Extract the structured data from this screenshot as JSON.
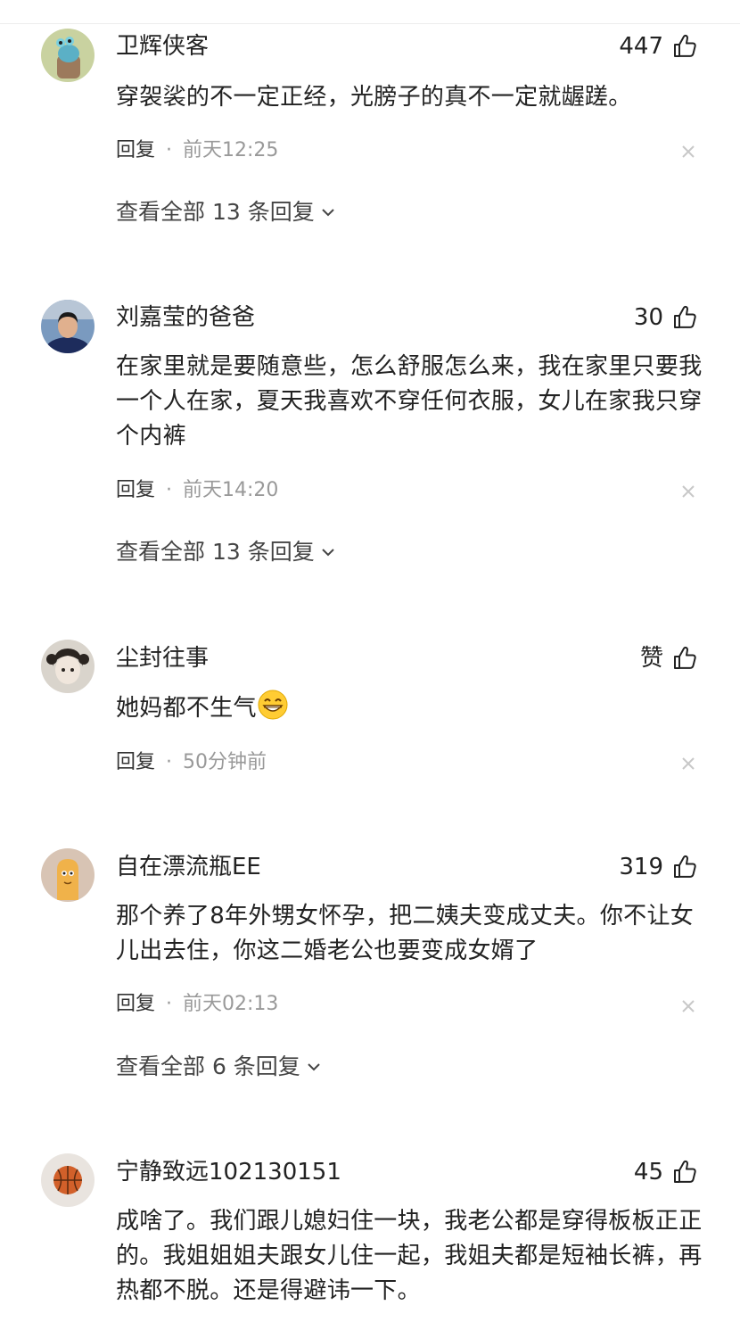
{
  "comments": [
    {
      "username": "卫辉侠客",
      "likes": "447",
      "text": "穿袈裟的不一定正经，光膀子的真不一定就龌蹉。",
      "reply_label": "回复",
      "separator": "·",
      "time": "前天12:25",
      "view_all": "查看全部 13 条回复",
      "avatar_icon": "cartoon-avatar-icon"
    },
    {
      "username": "刘嘉莹的爸爸",
      "likes": "30",
      "text": "在家里就是要随意些，怎么舒服怎么来，我在家里只要我一个人在家，夏天我喜欢不穿任何衣服，女儿在家我只穿个内裤",
      "reply_label": "回复",
      "separator": "·",
      "time": "前天14:20",
      "view_all": "查看全部 13 条回复",
      "avatar_icon": "man-photo-avatar-icon"
    },
    {
      "username": "尘封往事",
      "likes": "赞",
      "text": "她妈都不生气",
      "reply_label": "回复",
      "separator": "·",
      "time": "50分钟前",
      "avatar_icon": "girl-photo-avatar-icon",
      "emoji": "grinning-face-emoji"
    },
    {
      "username": "自在漂流瓶EE",
      "likes": "319",
      "text": "那个养了8年外甥女怀孕，把二姨夫变成丈夫。你不让女儿出去住，你这二婚老公也要变成女婿了",
      "reply_label": "回复",
      "separator": "·",
      "time": "前天02:13",
      "view_all": "查看全部 6 条回复",
      "avatar_icon": "cartoon-character-avatar-icon"
    },
    {
      "username": "宁静致远102130151",
      "likes": "45",
      "text": "成啥了。我们跟儿媳妇住一块，我老公都是穿得板板正正的。我姐姐姐夫跟女儿住一起，我姐夫都是短袖长裤，再热都不脱。还是得避讳一下。",
      "avatar_icon": "basketball-avatar-icon"
    }
  ],
  "colors": {
    "text": "#222222",
    "meta": "#999999",
    "divider": "#ededed"
  }
}
